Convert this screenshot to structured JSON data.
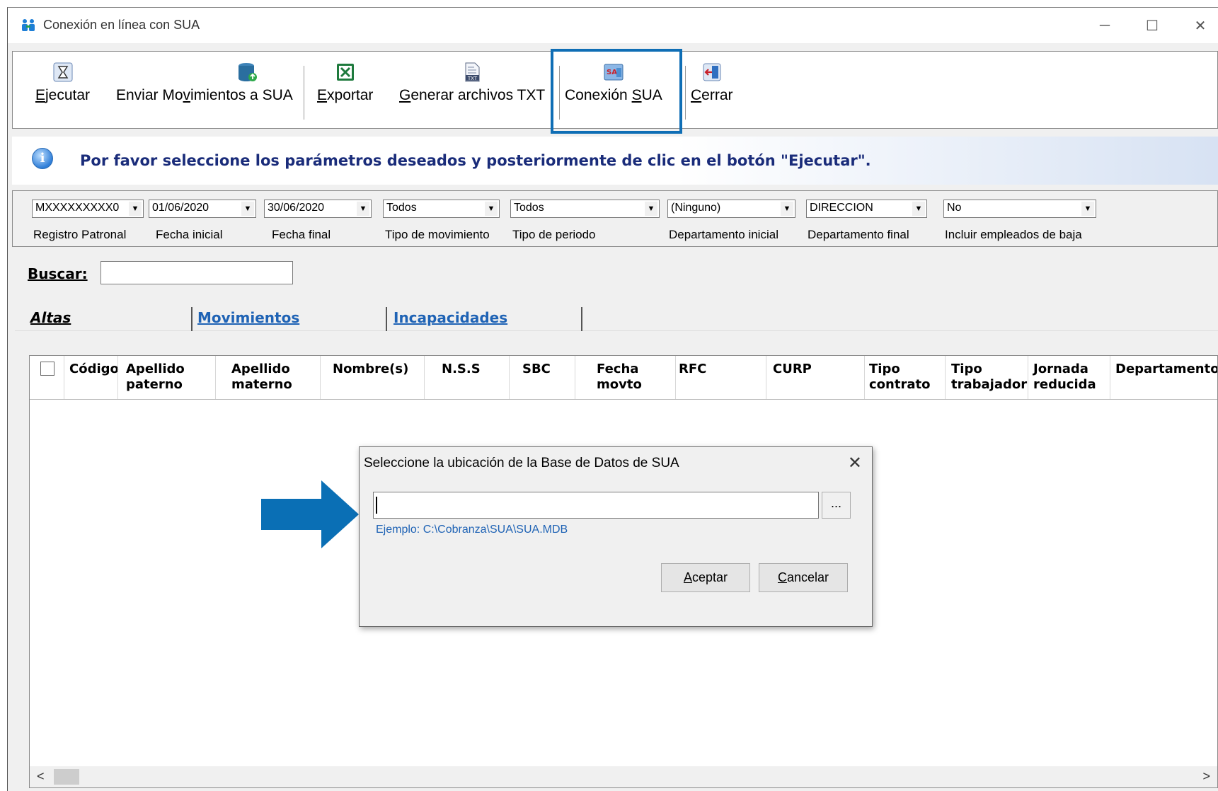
{
  "window": {
    "title": "Conexión en línea con SUA",
    "minimize": "─",
    "maximize": "☐",
    "close": "✕"
  },
  "toolbar": {
    "ejecutar_pre": "",
    "ejecutar_u": "E",
    "ejecutar_post": "jecutar",
    "enviar_pre": "Enviar  Mo",
    "enviar_u": "v",
    "enviar_post": "imientos a SUA",
    "exportar_pre": "",
    "exportar_u": "E",
    "exportar_post": "xportar",
    "generar_pre": "",
    "generar_u": "G",
    "generar_post": "enerar archivos TXT",
    "conexion_pre": "Conexión ",
    "conexion_u": "S",
    "conexion_post": "UA",
    "cerrar_pre": "",
    "cerrar_u": "C",
    "cerrar_post": "errar"
  },
  "info": {
    "message": "Por favor seleccione los parámetros deseados y posteriormente de clic en el botón \"Ejecutar\"."
  },
  "filters": {
    "registro_patronal": {
      "value": "MXXXXXXXXX0",
      "label": "Registro Patronal"
    },
    "fecha_inicial": {
      "value": "01/06/2020",
      "label": "Fecha inicial"
    },
    "fecha_final": {
      "value": "30/06/2020",
      "label": "Fecha final"
    },
    "tipo_movimiento": {
      "value": "Todos",
      "label": "Tipo de movimiento"
    },
    "tipo_periodo": {
      "value": "Todos",
      "label": "Tipo de  periodo"
    },
    "departamento_inicial": {
      "value": "(Ninguno)",
      "label": "Departamento inicial"
    },
    "departamento_final": {
      "value": "DIRECCION",
      "label": "Departamento final"
    },
    "incluir_baja": {
      "value": "No",
      "label": "Incluir empleados de baja"
    }
  },
  "search": {
    "label": "Buscar:",
    "value": ""
  },
  "tabs": [
    {
      "label": "Altas",
      "active": true
    },
    {
      "label": "Movimientos",
      "active": false
    },
    {
      "label": "Incapacidades",
      "active": false
    }
  ],
  "grid": {
    "columns": [
      "Código",
      "Apellido paterno",
      "Apellido materno",
      "Nombre(s)",
      "N.S.S",
      "SBC",
      "Fecha movto",
      "RFC",
      "CURP",
      "Tipo contrato",
      "Tipo trabajador",
      "Jornada reducida",
      "Departamento"
    ],
    "rows": []
  },
  "dialog": {
    "title": "Seleccione la ubicación de la Base de Datos de SUA",
    "close": "✕",
    "path_value": "",
    "browse_label": "...",
    "example": "Ejemplo: C:\\Cobranza\\SUA\\SUA.MDB",
    "aceptar_u": "A",
    "aceptar_post": "ceptar",
    "cancelar_u": "C",
    "cancelar_post": "ancelar"
  },
  "colors": {
    "highlight": "#0f6eb5",
    "arrow": "#0a6fb5",
    "info_text": "#1a2c7a",
    "tab_text": "#1f63b5"
  }
}
